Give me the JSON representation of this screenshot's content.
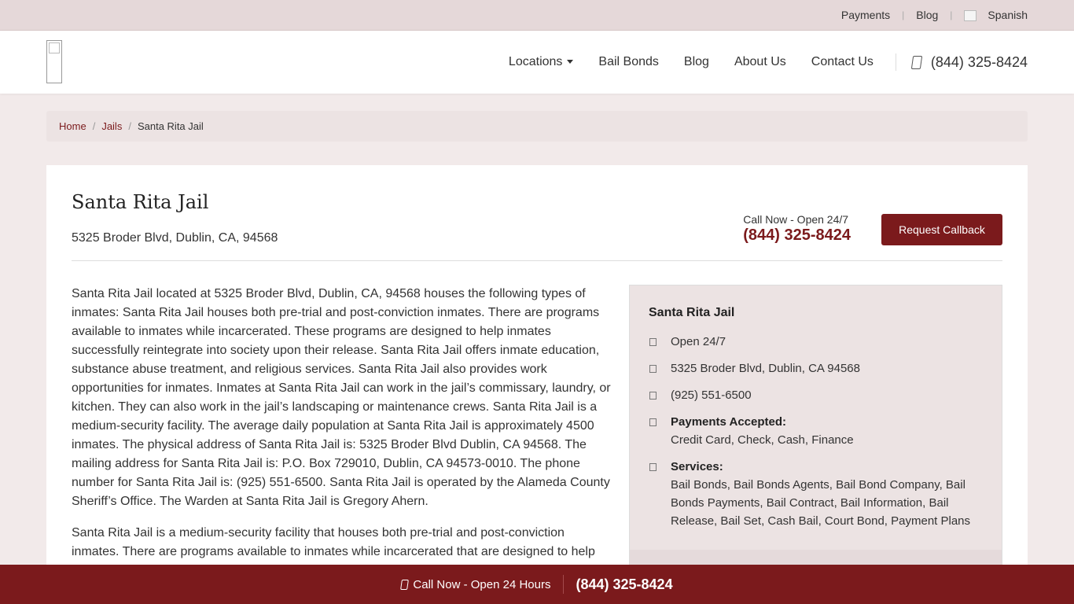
{
  "topbar": {
    "links": [
      "Payments",
      "Blog"
    ],
    "language": "Spanish"
  },
  "header": {
    "nav": [
      "Locations",
      "Bail Bonds",
      "Blog",
      "About Us",
      "Contact Us"
    ],
    "phone": "(844) 325-8424"
  },
  "breadcrumb": {
    "home": "Home",
    "jails": "Jails",
    "current": "Santa Rita Jail"
  },
  "main": {
    "title": "Santa Rita Jail",
    "address": "5325 Broder Blvd, Dublin, CA, 94568",
    "call_label": "Call Now - Open 24/7",
    "call_phone": "(844) 325-8424",
    "callback_label": "Request Callback",
    "paragraphs": [
      "Santa Rita Jail located at 5325 Broder Blvd, Dublin, CA, 94568 houses the following types of inmates: Santa Rita Jail houses both pre-trial and post-conviction inmates. There are programs available to inmates while incarcerated. These programs are designed to help inmates successfully reintegrate into society upon their release. Santa Rita Jail offers inmate education, substance abuse treatment, and religious services. Santa Rita Jail also provides work opportunities for inmates. Inmates at Santa Rita Jail can work in the jail’s commissary, laundry, or kitchen. They can also work in the jail’s landscaping or maintenance crews. Santa Rita Jail is a medium-security facility. The average daily population at Santa Rita Jail is approximately 4500 inmates. The physical address of Santa Rita Jail is: 5325 Broder Blvd Dublin, CA 94568. The mailing address for Santa Rita Jail is: P.O. Box 729010, Dublin, CA 94573-0010. The phone number for Santa Rita Jail is: (925) 551-6500. Santa Rita Jail is operated by the Alameda County Sheriff’s Office. The Warden at Santa Rita Jail is Gregory Ahern.",
      "Santa Rita Jail is a medium-security facility that houses both pre-trial and post-conviction inmates. There are programs available to inmates while incarcerated that are designed to help"
    ]
  },
  "info": {
    "title": "Santa Rita Jail",
    "hours": "Open 24/7",
    "address": "5325 Broder Blvd, Dublin, CA 94568",
    "phone": "(925) 551-6500",
    "payments_label": "Payments Accepted:",
    "payments": "Credit Card, Check, Cash, Finance",
    "services_label": "Services:",
    "services": "Bail Bonds, Bail Bonds Agents, Bail Bond Company, Bail Bonds Payments, Bail Contract, Bail Information, Bail Release, Bail Set, Cash Bail, Court Bond, Payment Plans"
  },
  "bottombar": {
    "label": "Call Now - Open 24 Hours",
    "phone": "(844) 325-8424"
  },
  "colors": {
    "brand": "#7b1a1c",
    "topbar": "#e5d8d9",
    "page_bg": "#f2eaea"
  }
}
